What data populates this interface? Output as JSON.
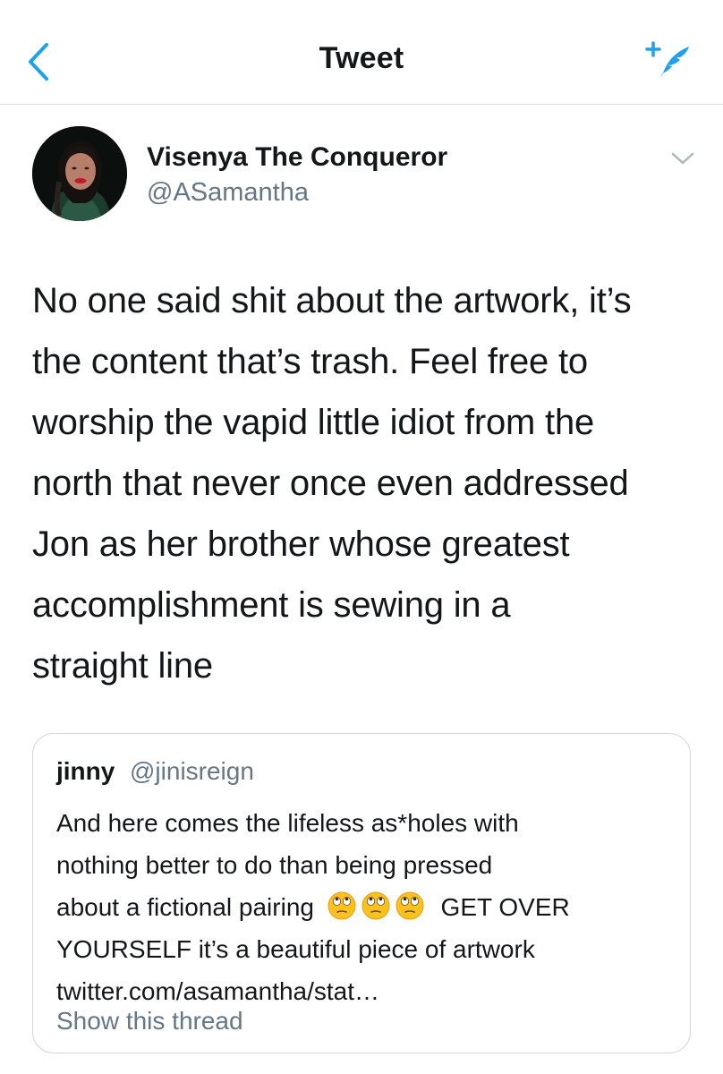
{
  "header": {
    "title": "Tweet",
    "back_icon": "chevron-left-icon",
    "compose_icon": "compose-tweet-icon",
    "accent_color": "#1da1f2"
  },
  "tweet": {
    "display_name": "Visenya The Conqueror",
    "handle": "@ASamantha",
    "lines": [
      "No one said shit about the artwork, it’s",
      "the content that’s trash. Feel free to",
      "worship the vapid little idiot from the",
      "north that never once even addressed",
      "Jon as her brother whose greatest",
      "accomplishment is sewing in a",
      "straight line"
    ]
  },
  "quote": {
    "display_name": "jinny",
    "handle": "@jinisreign",
    "line1": "And here comes the lifeless as*holes with",
    "line2": "nothing better to do than being pressed",
    "line3_before": "about a fictional pairing",
    "emoji": "face-with-rolling-eyes-icon",
    "emoji_count": 3,
    "line3_after": "GET OVER",
    "line4": "YOURSELF it’s a beautiful piece of artwork",
    "line5": "twitter.com/asamantha/stat…",
    "show_thread": "Show this thread"
  }
}
